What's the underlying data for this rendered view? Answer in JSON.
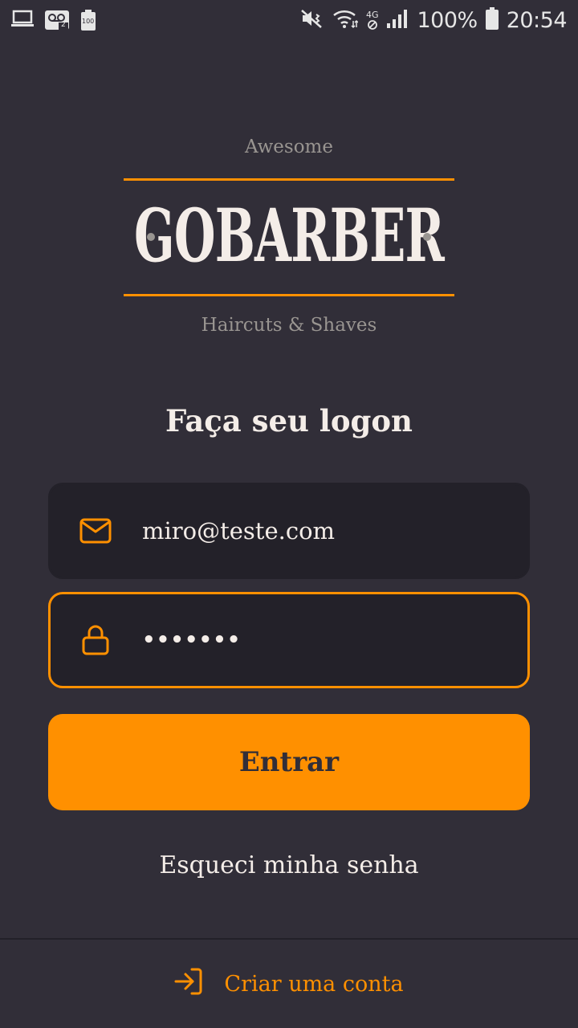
{
  "status_bar": {
    "battery_percent": "100%",
    "time": "20:54",
    "voicemail_count": "2",
    "battery_small": "100",
    "network": "4G"
  },
  "logo": {
    "top_text": "Awesome",
    "name": "GOBARBER",
    "bottom_text": "Haircuts & Shaves"
  },
  "form": {
    "title": "Faça seu logon",
    "email_value": "miro@teste.com",
    "password_value": "•••••••",
    "submit_label": "Entrar",
    "forgot_label": "Esqueci minha senha"
  },
  "footer": {
    "create_account_label": "Criar uma conta"
  },
  "colors": {
    "background": "#312e38",
    "input_bg": "#232129",
    "accent": "#ff9000",
    "text": "#f4ede8",
    "muted": "#999591"
  },
  "icons": {
    "email": "mail-icon",
    "password": "lock-icon",
    "create": "log-in-icon"
  }
}
